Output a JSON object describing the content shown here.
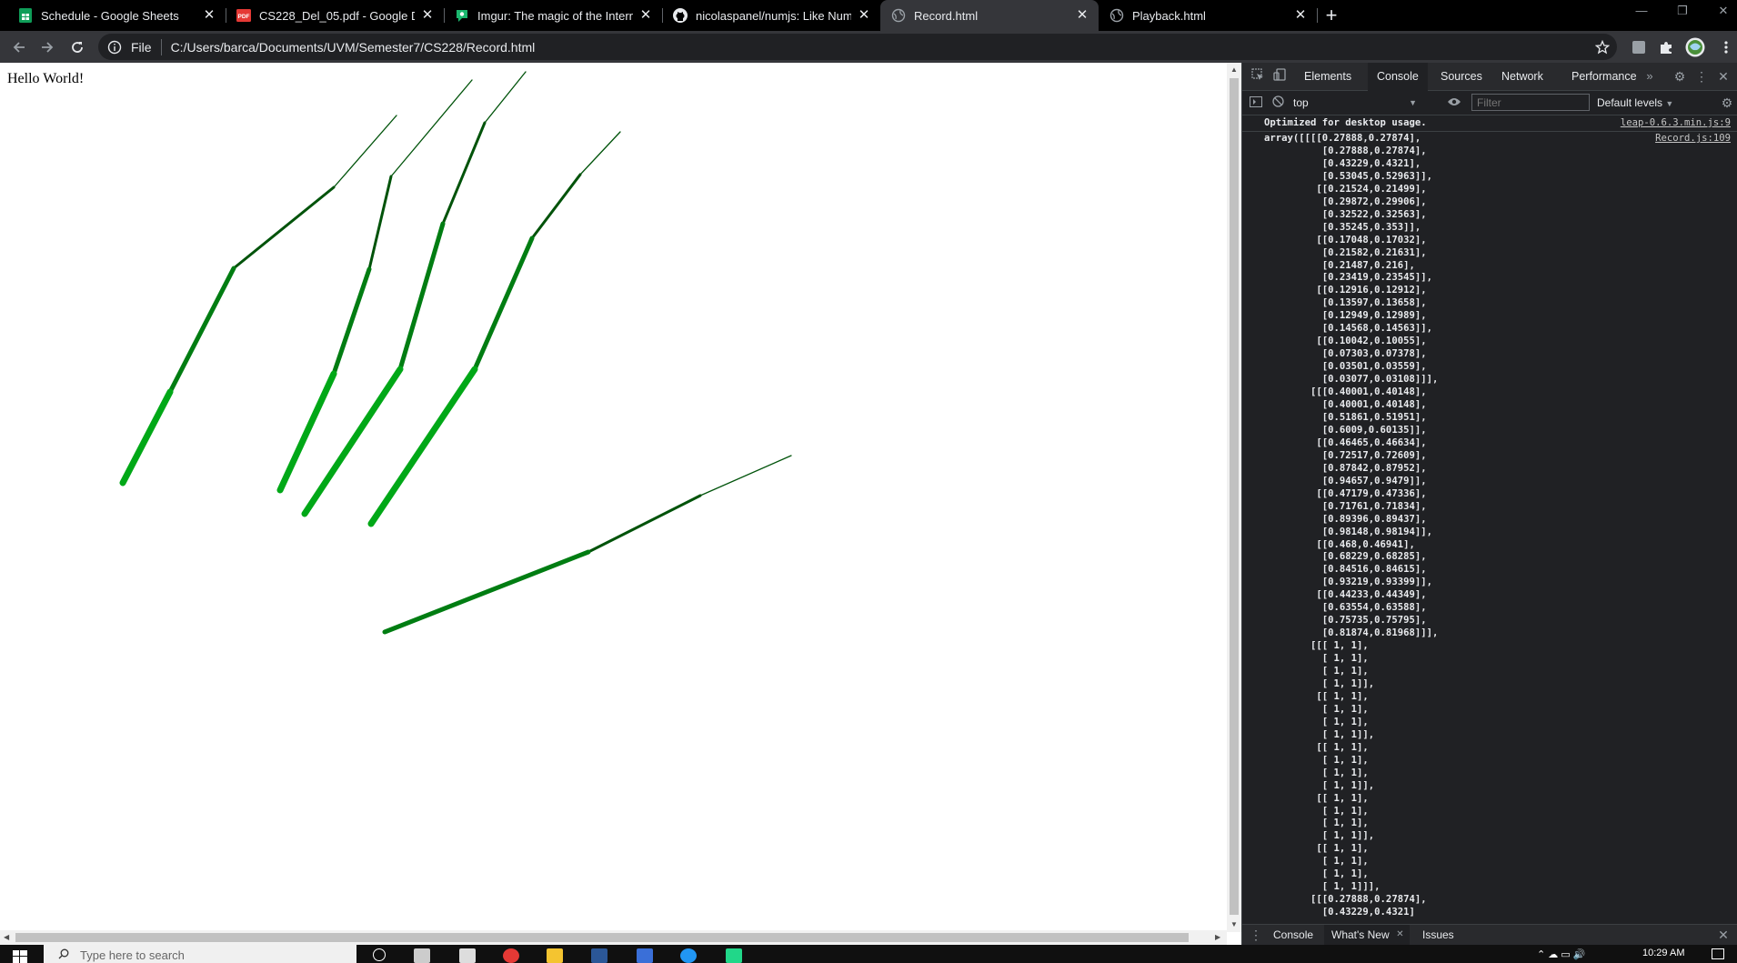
{
  "browser": {
    "tabs": [
      {
        "title": "Schedule - Google Sheets",
        "icon": "sheets-icon",
        "active": false
      },
      {
        "title": "CS228_Del_05.pdf - Google Drive",
        "icon": "pdf-icon",
        "active": false
      },
      {
        "title": "Imgur: The magic of the Internet",
        "icon": "imgur-icon",
        "active": false
      },
      {
        "title": "nicolaspanel/numjs: Like NumPy",
        "icon": "github-icon",
        "active": false
      },
      {
        "title": "Record.html",
        "icon": "globe-icon",
        "active": true
      },
      {
        "title": "Playback.html",
        "icon": "globe-icon",
        "active": false
      }
    ],
    "address": {
      "scheme_label": "File",
      "url": "C:/Users/barca/Documents/UVM/Semester7/CS228/Record.html"
    }
  },
  "page": {
    "hello_text": "Hello World!"
  },
  "devtools": {
    "tabs": [
      "Elements",
      "Console",
      "Sources",
      "Network",
      "Performance"
    ],
    "active_tab": "Console",
    "context": "top",
    "filter_placeholder": "Filter",
    "levels": "Default levels",
    "messages": [
      {
        "text": "Optimized for desktop usage.",
        "source": "leap-0.6.3.min.js:9"
      },
      {
        "text": "array([[[[0.27888,0.27874],\n          [0.27888,0.27874],\n          [0.43229,0.4321],\n          [0.53045,0.52963]],\n         [[0.21524,0.21499],\n          [0.29872,0.29906],\n          [0.32522,0.32563],\n          [0.35245,0.353]],\n         [[0.17048,0.17032],\n          [0.21582,0.21631],\n          [0.21487,0.216],\n          [0.23419,0.23545]],\n         [[0.12916,0.12912],\n          [0.13597,0.13658],\n          [0.12949,0.12989],\n          [0.14568,0.14563]],\n         [[0.10042,0.10055],\n          [0.07303,0.07378],\n          [0.03501,0.03559],\n          [0.03077,0.03108]]],\n        [[[0.40001,0.40148],\n          [0.40001,0.40148],\n          [0.51861,0.51951],\n          [0.6009,0.60135]],\n         [[0.46465,0.46634],\n          [0.72517,0.72609],\n          [0.87842,0.87952],\n          [0.94657,0.9479]],\n         [[0.47179,0.47336],\n          [0.71761,0.71834],\n          [0.89396,0.89437],\n          [0.98148,0.98194]],\n         [[0.468,0.46941],\n          [0.68229,0.68285],\n          [0.84516,0.84615],\n          [0.93219,0.93399]],\n         [[0.44233,0.44349],\n          [0.63554,0.63588],\n          [0.75735,0.75795],\n          [0.81874,0.81968]]],\n        [[[ 1, 1],\n          [ 1, 1],\n          [ 1, 1],\n          [ 1, 1]],\n         [[ 1, 1],\n          [ 1, 1],\n          [ 1, 1],\n          [ 1, 1]],\n         [[ 1, 1],\n          [ 1, 1],\n          [ 1, 1],\n          [ 1, 1]],\n         [[ 1, 1],\n          [ 1, 1],\n          [ 1, 1],\n          [ 1, 1]],\n         [[ 1, 1],\n          [ 1, 1],\n          [ 1, 1],\n          [ 1, 1]]],\n        [[[0.27888,0.27874],\n          [0.43229,0.4321]",
        "source": "Record.js:109"
      }
    ],
    "drawer_tabs": [
      "Console",
      "What's New",
      "Issues"
    ],
    "drawer_active": "What's New"
  },
  "taskbar": {
    "search_placeholder": "Type here to search",
    "clock": "10:29 AM"
  },
  "colors": {
    "dark_green": "#00530a",
    "mid_green": "#007d12",
    "light_green": "#00b41a",
    "console_bg": "#202124",
    "tab_active_bg": "#35363a"
  }
}
